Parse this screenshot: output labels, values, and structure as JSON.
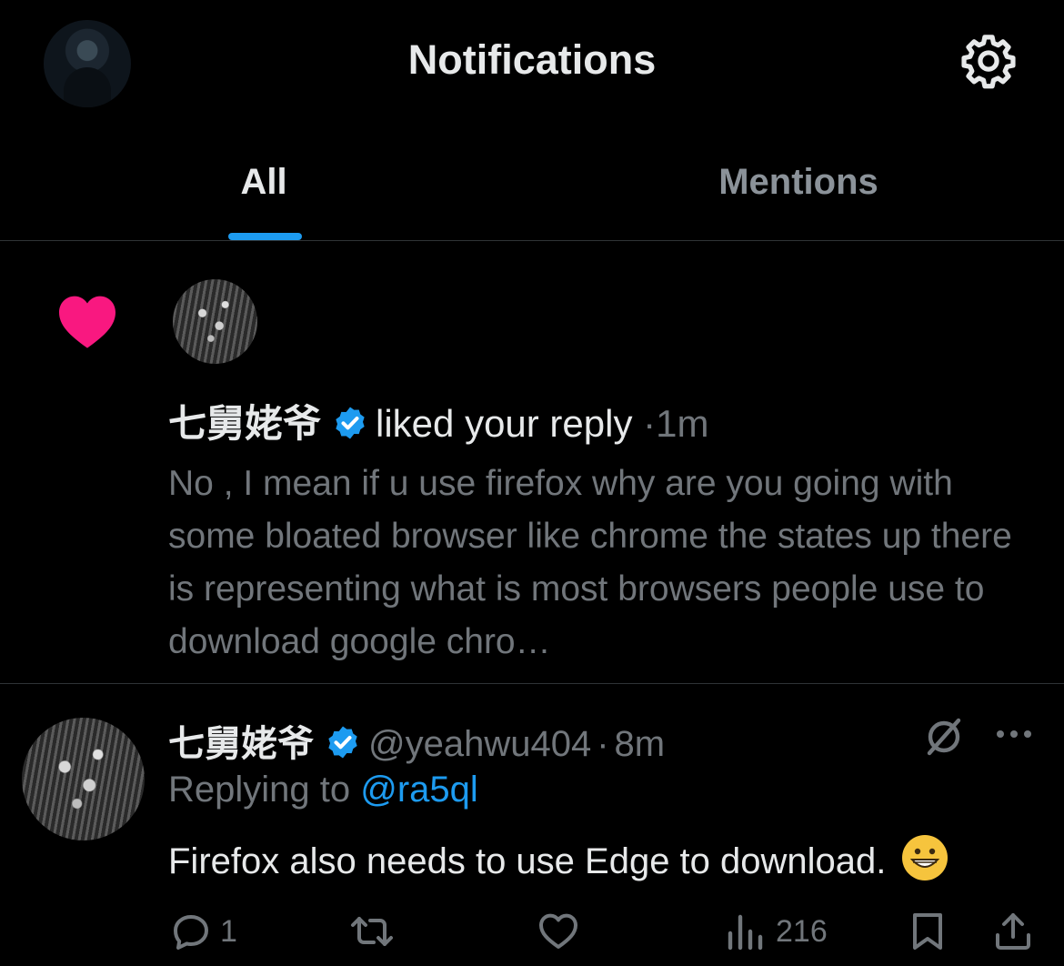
{
  "header": {
    "title": "Notifications",
    "avatar_icon": "profile-avatar",
    "settings_icon": "gear-icon"
  },
  "tabs": [
    {
      "label": "All",
      "active": true
    },
    {
      "label": "Mentions",
      "active": false
    }
  ],
  "like_notification": {
    "icon": "heart-icon",
    "icon_color": "#f91880",
    "user_name": "七舅姥爷",
    "verified": true,
    "action_text": "liked your reply",
    "separator": "·",
    "time": "1m",
    "reply_preview": "No , I mean if u use firefox why are you going with some bloated browser like chrome the states up there is representing what is most browsers people use to download google chro…"
  },
  "tweet": {
    "user_name": "七舅姥爷",
    "verified": true,
    "handle": "@yeahwu404",
    "separator": "·",
    "time": "8m",
    "replying_prefix": "Replying to",
    "replying_handle": "@ra5ql",
    "text": "Firefox also needs to use Edge to download.",
    "emoji": "grinning-face",
    "actions": {
      "replies": "1",
      "views": "216"
    }
  },
  "colors": {
    "accent": "#1d9bf0",
    "like": "#f91880",
    "muted": "#71767b",
    "text": "#e7e9ea",
    "background": "#000000"
  }
}
